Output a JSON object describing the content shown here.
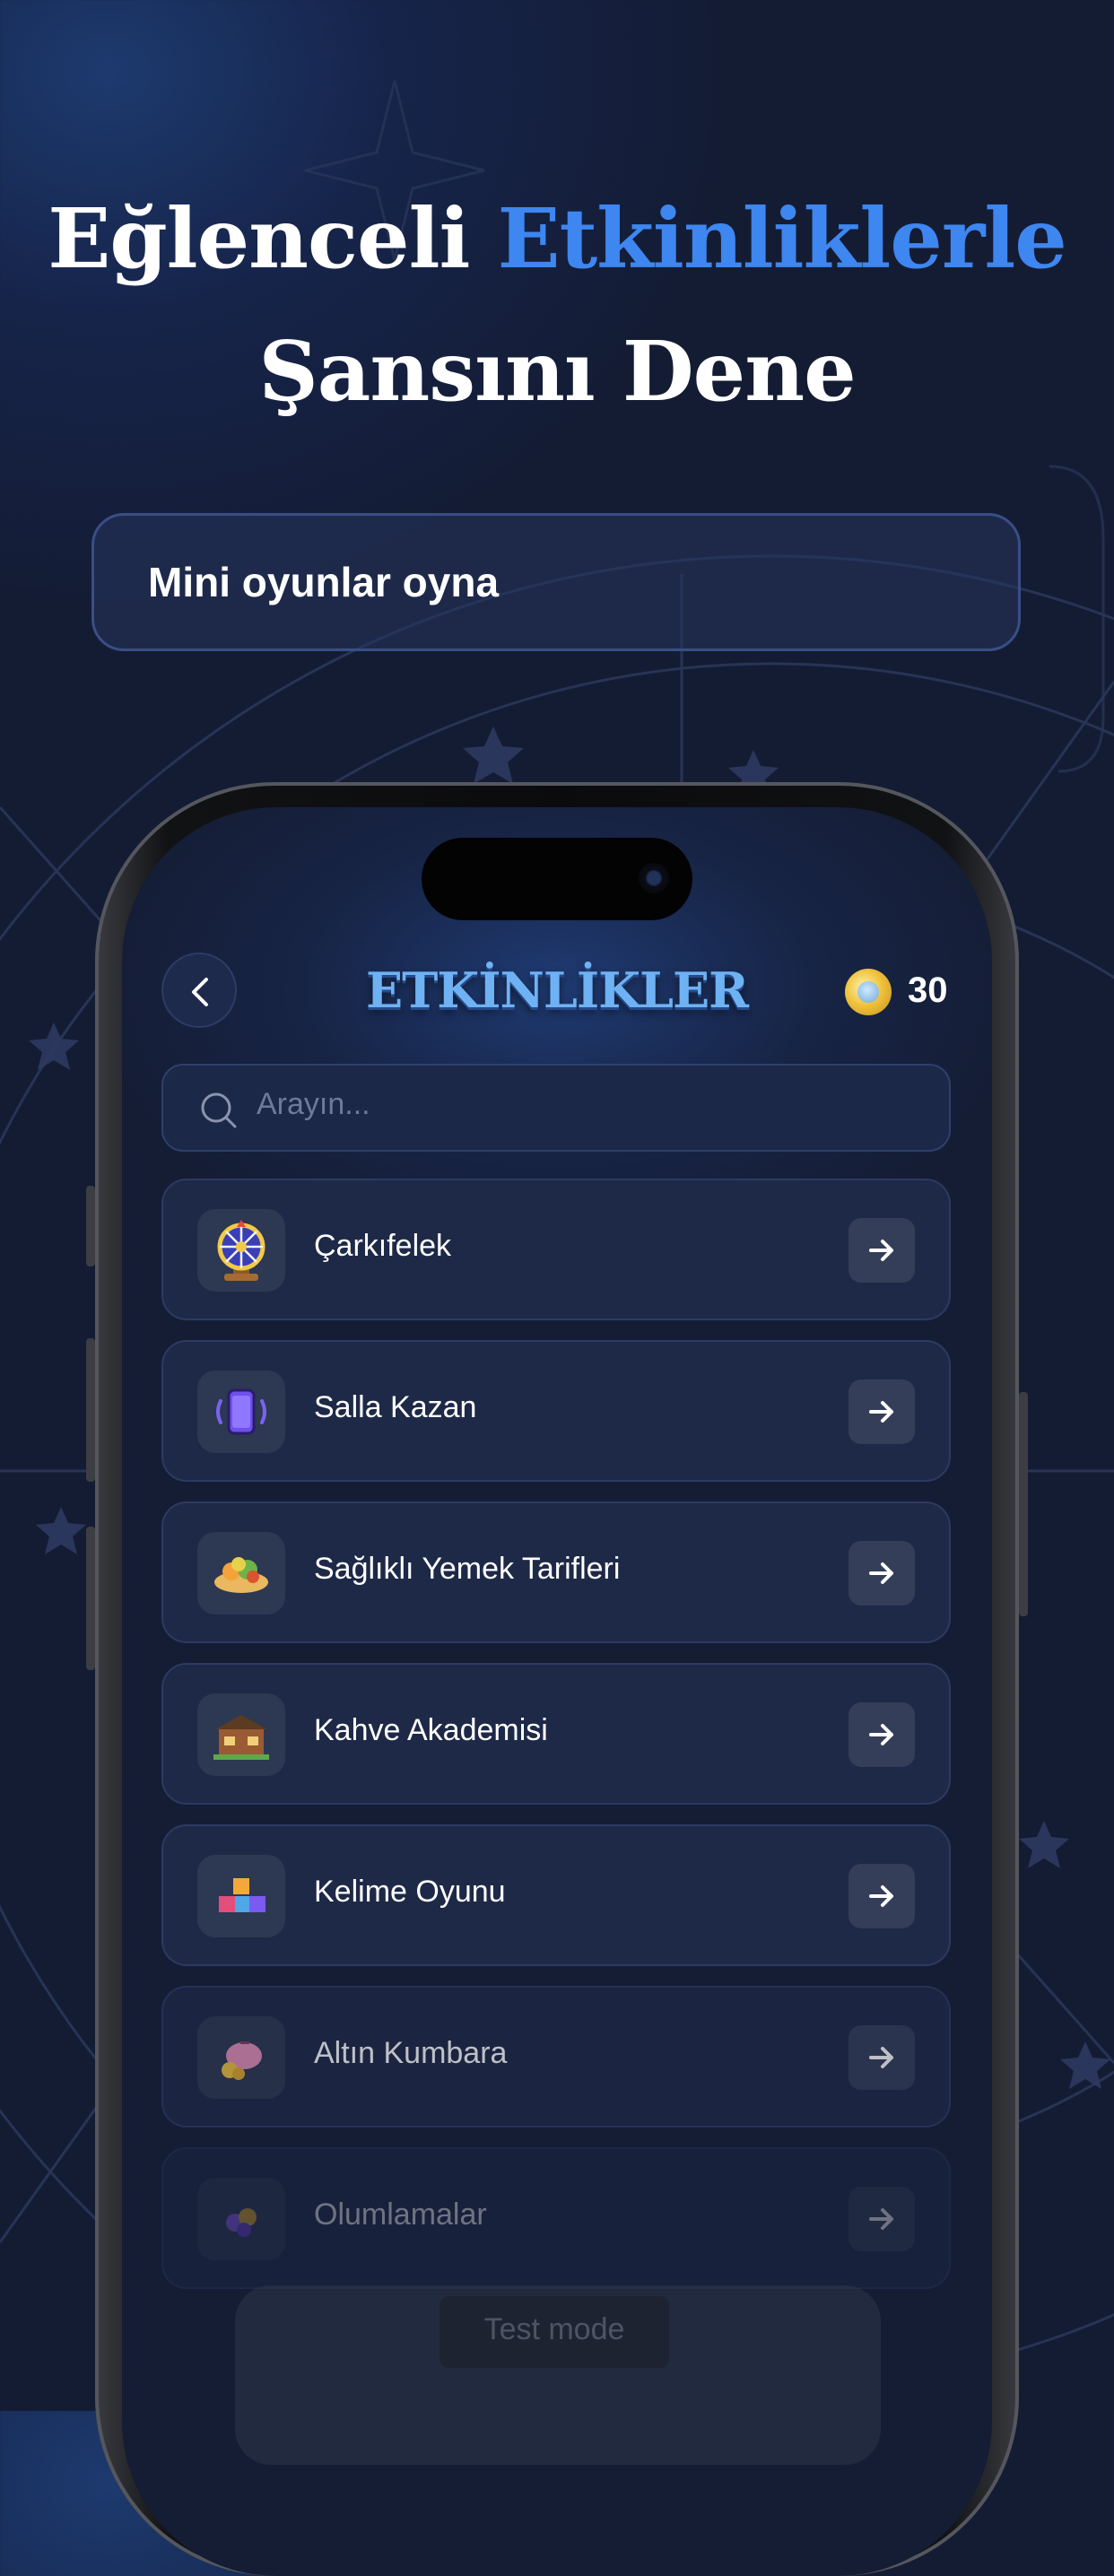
{
  "headline": {
    "part1": "Eğlenceli",
    "accent": "Etkinliklerle",
    "line2": "Şansını Dene"
  },
  "subtitle": "Mini oyunlar oyna",
  "app": {
    "title": "ETKİNLİKLER",
    "coins": "30",
    "search_placeholder": "Arayın...",
    "activities": [
      {
        "label": "Çarkıfelek",
        "icon": "wheel-of-fortune-icon"
      },
      {
        "label": "Salla Kazan",
        "icon": "shake-phone-icon"
      },
      {
        "label": "Sağlıklı Yemek Tarifleri",
        "icon": "healthy-food-icon"
      },
      {
        "label": "Kahve Akademisi",
        "icon": "coffee-shop-icon"
      },
      {
        "label": "Kelime Oyunu",
        "icon": "letter-blocks-icon"
      },
      {
        "label": "Altın Kumbara",
        "icon": "piggy-bank-icon"
      },
      {
        "label": "Olumlamalar",
        "icon": "affirmations-icon"
      }
    ],
    "test_mode": "Test mode"
  },
  "colors": {
    "accent": "#3e86f0",
    "background": "#141c34",
    "card": "#1e2947"
  }
}
